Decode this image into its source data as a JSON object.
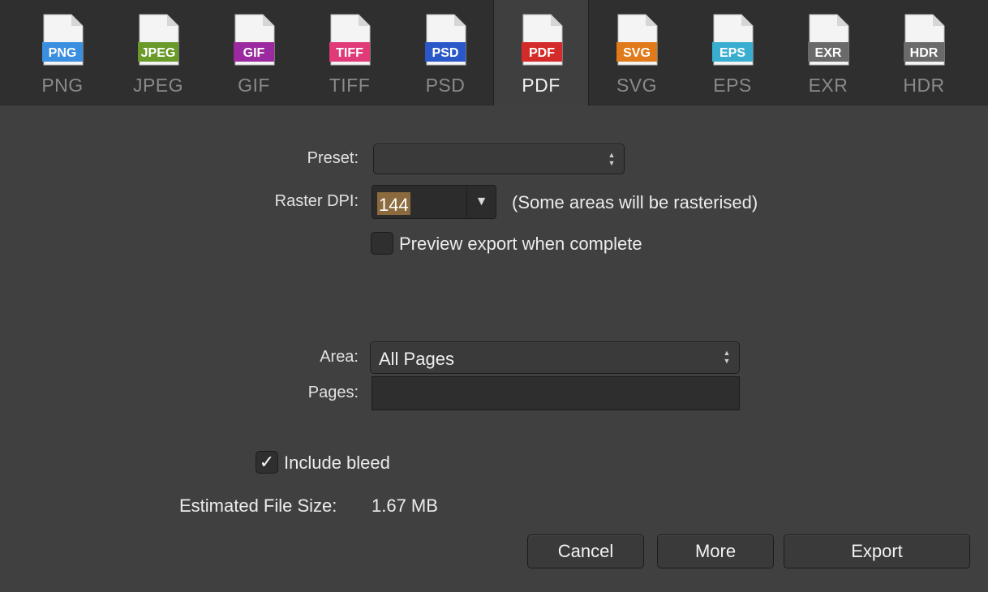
{
  "formats": [
    {
      "label": "PNG",
      "badge": "PNG",
      "color": "#3a8fe0",
      "icon": "png-file-icon"
    },
    {
      "label": "JPEG",
      "badge": "JPEG",
      "color": "#6a9a2a",
      "icon": "jpeg-file-icon"
    },
    {
      "label": "GIF",
      "badge": "GIF",
      "color": "#9b2aa0",
      "icon": "gif-file-icon"
    },
    {
      "label": "TIFF",
      "badge": "TIFF",
      "color": "#e03a78",
      "icon": "tiff-file-icon"
    },
    {
      "label": "PSD",
      "badge": "PSD",
      "color": "#2a58c8",
      "icon": "psd-file-icon"
    },
    {
      "label": "PDF",
      "badge": "PDF",
      "color": "#d42a2a",
      "icon": "pdf-file-icon"
    },
    {
      "label": "SVG",
      "badge": "SVG",
      "color": "#e07a1a",
      "icon": "svg-file-icon"
    },
    {
      "label": "EPS",
      "badge": "EPS",
      "color": "#3aaed0",
      "icon": "eps-file-icon"
    },
    {
      "label": "EXR",
      "badge": "EXR",
      "color": "#6a6a6a",
      "icon": "exr-file-icon"
    },
    {
      "label": "HDR",
      "badge": "HDR",
      "color": "#6a6a6a",
      "icon": "hdr-file-icon"
    }
  ],
  "selected_format": "PDF",
  "form": {
    "preset_label": "Preset:",
    "preset_value": "",
    "raster_dpi_label": "Raster DPI:",
    "raster_dpi_value": "144",
    "raster_note": "(Some areas will be rasterised)",
    "preview_label": "Preview export when complete",
    "preview_checked": false,
    "area_label": "Area:",
    "area_value": "All Pages",
    "pages_label": "Pages:",
    "pages_value": "",
    "bleed_label": "Include bleed",
    "bleed_checked": true,
    "filesize_label": "Estimated File Size:",
    "filesize_value": "1.67 MB"
  },
  "buttons": {
    "cancel": "Cancel",
    "more": "More",
    "export": "Export"
  },
  "icons": {
    "stepper": "stepper-icon",
    "dropdown": "dropdown-arrow-icon",
    "check": "checkmark-icon"
  }
}
